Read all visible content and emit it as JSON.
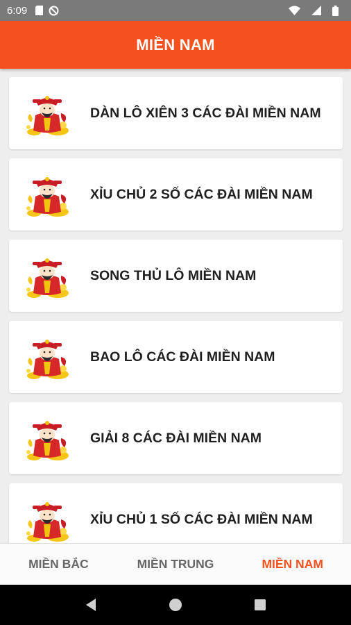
{
  "status_bar": {
    "time": "6:09",
    "icons": [
      "sim-card-icon",
      "do-not-disturb-icon",
      "wifi-icon",
      "signal-icon",
      "battery-icon"
    ]
  },
  "app_bar": {
    "title": "MIỀN NAM"
  },
  "list": {
    "items": [
      {
        "label": "DÀN LÔ XIÊN 3 CÁC ĐÀI MIỀN NAM",
        "icon": "god-of-wealth-icon"
      },
      {
        "label": "XỈU CHỦ 2 SỐ CÁC ĐÀI MIỀN NAM",
        "icon": "god-of-wealth-icon"
      },
      {
        "label": "SONG THỦ LÔ MIỀN NAM",
        "icon": "god-of-wealth-icon"
      },
      {
        "label": "BAO LÔ CÁC ĐÀI MIỀN NAM",
        "icon": "god-of-wealth-icon"
      },
      {
        "label": "GIẢI 8 CÁC ĐÀI MIỀN NAM",
        "icon": "god-of-wealth-icon"
      },
      {
        "label": "XỈU CHỦ 1 SỐ CÁC ĐÀI MIỀN NAM",
        "icon": "god-of-wealth-icon"
      }
    ]
  },
  "bottom_nav": {
    "tabs": [
      {
        "label": "MIỀN BẮC",
        "active": false
      },
      {
        "label": "MIỀN TRUNG",
        "active": false
      },
      {
        "label": "MIỀN NAM",
        "active": true
      }
    ],
    "active_color": "#f4511e"
  },
  "system_nav": {
    "buttons": [
      "back-icon",
      "home-icon",
      "recents-icon"
    ]
  },
  "colors": {
    "accent": "#f4511e",
    "status_bar": "#7a7a7a",
    "background": "#eeeeee"
  }
}
